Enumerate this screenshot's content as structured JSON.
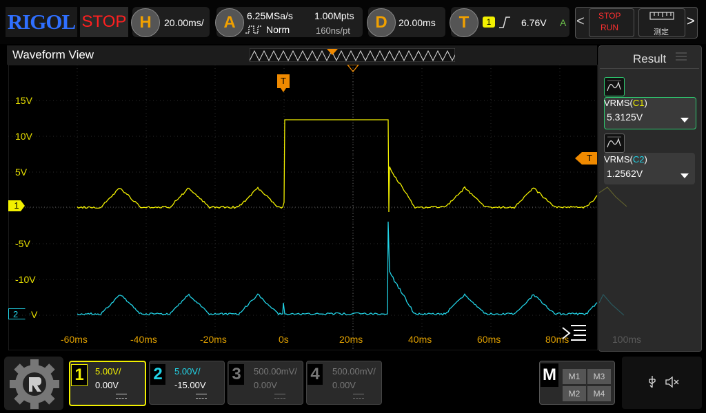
{
  "brand": "RIGOL",
  "run_state": "STOP",
  "horizontal": {
    "badge": "H",
    "value": "20.00ms/"
  },
  "acquire": {
    "badge": "A",
    "sample_rate": "6.25MSa/s",
    "mode": "Norm",
    "memory": "1.00Mpts",
    "interval": "160ns/pt"
  },
  "delay": {
    "badge": "D",
    "value": "20.00ms"
  },
  "trigger": {
    "badge": "T",
    "source": "1",
    "level": "6.76V",
    "sweep": "A"
  },
  "nav": {
    "prev": "<",
    "next": ">",
    "stop_label": "STOP",
    "run_label": "RUN",
    "measure_label": "测定"
  },
  "waveform_view": {
    "title": "Waveform View",
    "trigger_marker": "T",
    "right_trigger_marker": "T"
  },
  "y_labels": [
    "15V",
    "10V",
    "5V",
    "-5V",
    "-10V"
  ],
  "ch1_marker": "1",
  "ch2_marker": "2",
  "ch2_marker_suffix": "V",
  "x_labels": [
    "-60ms",
    "-40ms",
    "-20ms",
    "0s",
    "20ms",
    "40ms",
    "60ms",
    "80ms",
    "100ms"
  ],
  "result_panel": {
    "title": "Result",
    "items": [
      {
        "name": "VRMS(",
        "channel": "C1",
        "close": ")",
        "value": "5.3125V"
      },
      {
        "name": "VRMS(",
        "channel": "C2",
        "close": ")",
        "value": "1.2562V"
      }
    ]
  },
  "channels": [
    {
      "num": "1",
      "scale": "5.00V/",
      "offset": "0.00V",
      "active": true
    },
    {
      "num": "2",
      "scale": "5.00V/",
      "offset": "-15.00V",
      "active": true
    },
    {
      "num": "3",
      "scale": "500.00mV/",
      "offset": "0.00V",
      "active": false
    },
    {
      "num": "4",
      "scale": "500.00mV/",
      "offset": "0.00V",
      "active": false
    }
  ],
  "math": {
    "label": "M",
    "items": [
      "M1",
      "M3",
      "M2",
      "M4"
    ]
  },
  "colors": {
    "ch1": "#f2f000",
    "ch2": "#22d3e6",
    "trigger": "#f08a00",
    "accent": "#2ecc71"
  }
}
